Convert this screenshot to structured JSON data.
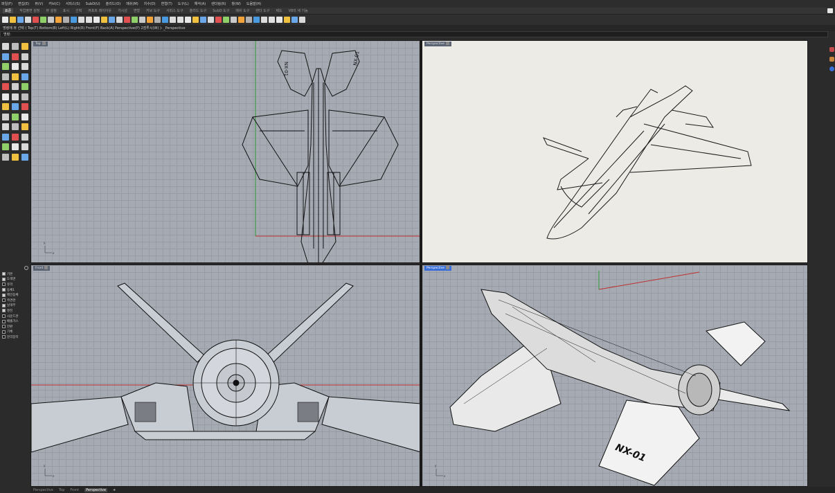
{
  "menu": [
    "파일(F)",
    "편집(E)",
    "뷰(V)",
    "커브(C)",
    "서피스(S)",
    "SubD(U)",
    "솔리드(O)",
    "메쉬(M)",
    "치수(D)",
    "변형(T)",
    "도구(L)",
    "해석(A)",
    "렌더링(R)",
    "창(W)",
    "도움말(H)"
  ],
  "toolbar_tabs": [
    "표준",
    "작업평면 설정",
    "뷰 설정",
    "표시",
    "선택",
    "뷰포트 레이아웃",
    "가시성",
    "변형",
    "커브 도구",
    "서피스 도구",
    "솔리드 도구",
    "SubD 도구",
    "메쉬 도구",
    "렌더 도구",
    "제도",
    "V8의 새 기능"
  ],
  "command_history": "명령에 뷰 선택 ( Top(T)  Bottom(B)  Left(L)  Right(R)  Front(F)  Back(A)  Perspective(P)  2점투시(W) ): _Perspective",
  "command_prompt": "명령:",
  "viewports": {
    "top_left": {
      "title": "Top"
    },
    "top_right": {
      "title": "Perspective"
    },
    "bottom_left": {
      "title": "Front"
    },
    "bottom_right": {
      "title": "Perspective"
    }
  },
  "axis_labels": {
    "x": "x",
    "y": "y"
  },
  "decal_text": "NX-01",
  "layers": [
    {
      "name": "기본",
      "checked": true
    },
    {
      "name": "도색면",
      "checked": true
    },
    {
      "name": "유리",
      "checked": false
    },
    {
      "name": "동체1",
      "checked": true
    },
    {
      "name": "메인동체",
      "checked": true
    },
    {
      "name": "측면관",
      "checked": false
    },
    {
      "name": "날개부",
      "checked": true
    },
    {
      "name": "엔진",
      "checked": true
    },
    {
      "name": "사운드관",
      "checked": false
    },
    {
      "name": "배출가스",
      "checked": false
    },
    {
      "name": "한판",
      "checked": false
    },
    {
      "name": "기체",
      "checked": false
    },
    {
      "name": "분리장치",
      "checked": false
    }
  ],
  "bottom_tabs": [
    "Perspective",
    "Top",
    "Front",
    "Perspective"
  ],
  "bottom_tabs_active": 3,
  "colors": {
    "accent": "#3a6fd8",
    "grid_bg": "#a5aab3",
    "x_axis": "#c03030",
    "y_axis": "#2f9a3a"
  }
}
